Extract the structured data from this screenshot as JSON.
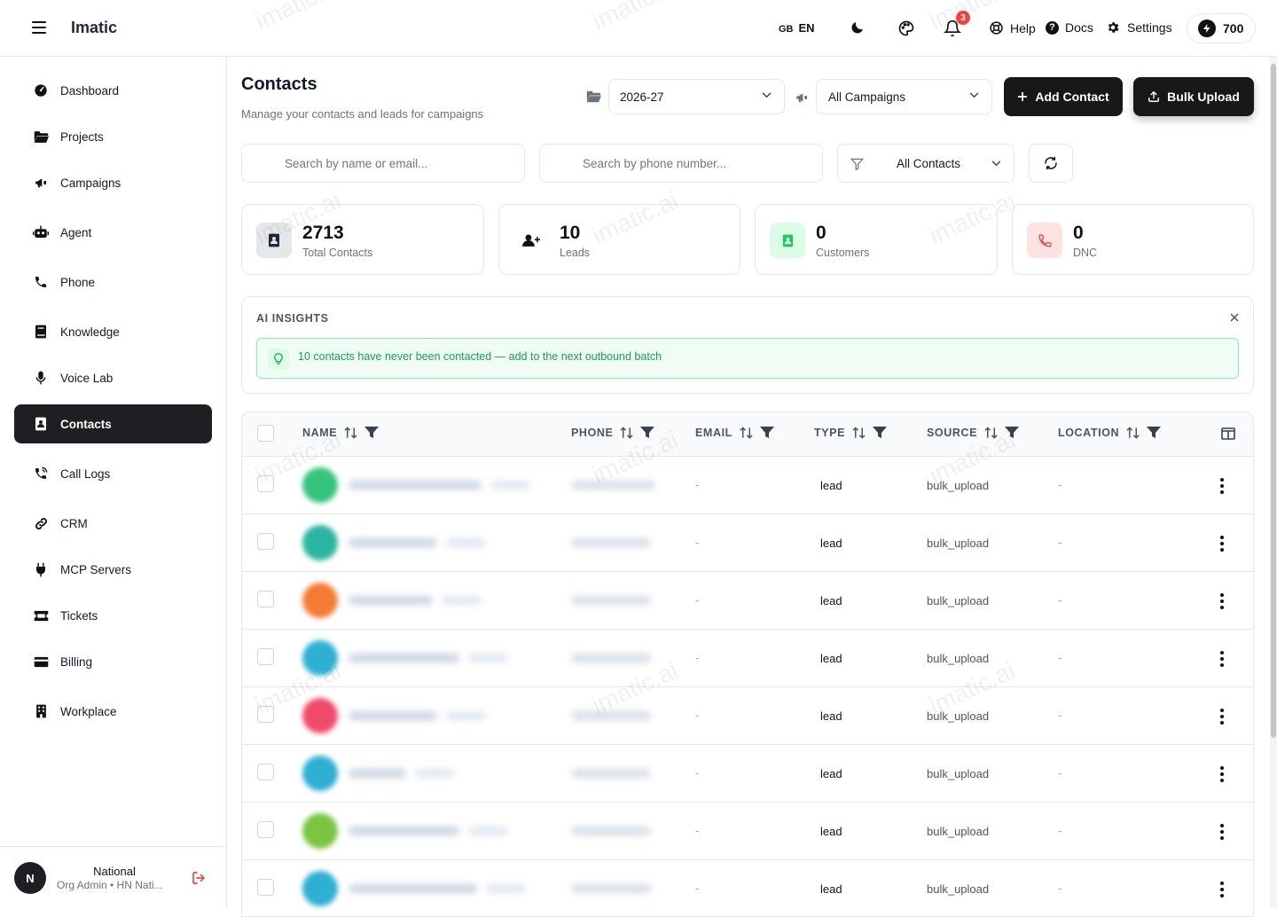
{
  "app": {
    "name": "Imatic",
    "watermark": "imatic.ai"
  },
  "topbar": {
    "lang_flag": "GB",
    "lang_code": "EN",
    "notif_count": "3",
    "help": "Help",
    "docs": "Docs",
    "settings": "Settings",
    "credits": "700"
  },
  "sidebar": {
    "items": [
      {
        "label": "Dashboard",
        "icon": "dashboard-icon"
      },
      {
        "label": "Projects",
        "icon": "folder-icon"
      },
      {
        "label": "Campaigns",
        "icon": "megaphone-icon"
      },
      {
        "label": "Agent",
        "icon": "robot-icon"
      },
      {
        "label": "Phone",
        "icon": "phone-icon"
      },
      {
        "label": "Knowledge",
        "icon": "book-icon"
      },
      {
        "label": "Voice Lab",
        "icon": "microphone-icon"
      },
      {
        "label": "Contacts",
        "icon": "contact-card-icon",
        "active": true
      },
      {
        "label": "Call Logs",
        "icon": "phone-log-icon"
      },
      {
        "label": "CRM",
        "icon": "link-icon"
      },
      {
        "label": "MCP Servers",
        "icon": "plug-icon"
      },
      {
        "label": "Tickets",
        "icon": "ticket-icon"
      },
      {
        "label": "Billing",
        "icon": "credit-card-icon"
      },
      {
        "label": "Workplace",
        "icon": "building-icon"
      }
    ],
    "user": {
      "initial": "N",
      "name": "National",
      "role": "Org Admin • HN Nati..."
    }
  },
  "page": {
    "title": "Contacts",
    "subtitle": "Manage your contacts and leads for campaigns",
    "year_select": "2026-27",
    "campaign_select": "All Campaigns",
    "add_contact": "Add Contact",
    "bulk_upload": "Bulk Upload"
  },
  "filters": {
    "search_name_placeholder": "Search by name or email...",
    "search_phone_placeholder": "Search by phone number...",
    "contact_filter": "All Contacts"
  },
  "stats": [
    {
      "value": "2713",
      "label": "Total Contacts"
    },
    {
      "value": "10",
      "label": "Leads"
    },
    {
      "value": "0",
      "label": "Customers"
    },
    {
      "value": "0",
      "label": "DNC"
    }
  ],
  "insights": {
    "title": "AI INSIGHTS",
    "message": "10 contacts have never been contacted — add to the next outbound batch"
  },
  "table": {
    "columns": [
      "NAME",
      "PHONE",
      "EMAIL",
      "TYPE",
      "SOURCE",
      "LOCATION"
    ],
    "rows": [
      {
        "email": "-",
        "type": "lead",
        "source": "bulk_upload",
        "location": "-",
        "avatar_color": "#34c47c"
      },
      {
        "email": "-",
        "type": "lead",
        "source": "bulk_upload",
        "location": "-",
        "avatar_color": "#2bb5a0"
      },
      {
        "email": "-",
        "type": "lead",
        "source": "bulk_upload",
        "location": "-",
        "avatar_color": "#f47b36"
      },
      {
        "email": "-",
        "type": "lead",
        "source": "bulk_upload",
        "location": "-",
        "avatar_color": "#2eb0d4"
      },
      {
        "email": "-",
        "type": "lead",
        "source": "bulk_upload",
        "location": "-",
        "avatar_color": "#f04a6a"
      },
      {
        "email": "-",
        "type": "lead",
        "source": "bulk_upload",
        "location": "-",
        "avatar_color": "#2eb0d4"
      },
      {
        "email": "-",
        "type": "lead",
        "source": "bulk_upload",
        "location": "-",
        "avatar_color": "#7cc442"
      },
      {
        "email": "-",
        "type": "lead",
        "source": "bulk_upload",
        "location": "-",
        "avatar_color": "#2eb0d4"
      }
    ]
  }
}
